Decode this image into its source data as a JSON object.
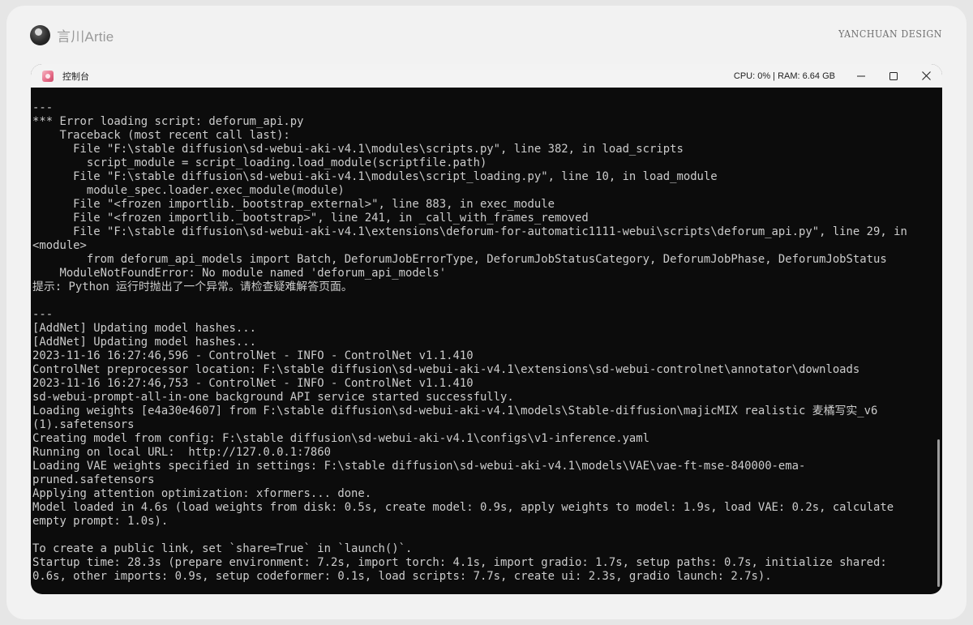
{
  "brand": {
    "name": "言川Artie",
    "design_label": "YANCHUAN DESIGN"
  },
  "window": {
    "title": "控制台",
    "status": "CPU: 0% | RAM: 6.64 GB",
    "controls": {
      "minimize": "minimize-icon",
      "maximize": "maximize-icon",
      "close": "close-icon"
    }
  },
  "console_lines": [
    "---",
    "*** Error loading script: deforum_api.py",
    "    Traceback (most recent call last):",
    "      File \"F:\\stable diffusion\\sd-webui-aki-v4.1\\modules\\scripts.py\", line 382, in load_scripts",
    "        script_module = script_loading.load_module(scriptfile.path)",
    "      File \"F:\\stable diffusion\\sd-webui-aki-v4.1\\modules\\script_loading.py\", line 10, in load_module",
    "        module_spec.loader.exec_module(module)",
    "      File \"<frozen importlib._bootstrap_external>\", line 883, in exec_module",
    "      File \"<frozen importlib._bootstrap>\", line 241, in _call_with_frames_removed",
    "      File \"F:\\stable diffusion\\sd-webui-aki-v4.1\\extensions\\deforum-for-automatic1111-webui\\scripts\\deforum_api.py\", line 29, in",
    "<module>",
    "        from deforum_api_models import Batch, DeforumJobErrorType, DeforumJobStatusCategory, DeforumJobPhase, DeforumJobStatus",
    "    ModuleNotFoundError: No module named 'deforum_api_models'",
    "提示: Python 运行时抛出了一个异常。请检查疑难解答页面。",
    "",
    "---",
    "[AddNet] Updating model hashes...",
    "[AddNet] Updating model hashes...",
    "2023-11-16 16:27:46,596 - ControlNet - INFO - ControlNet v1.1.410",
    "ControlNet preprocessor location: F:\\stable diffusion\\sd-webui-aki-v4.1\\extensions\\sd-webui-controlnet\\annotator\\downloads",
    "2023-11-16 16:27:46,753 - ControlNet - INFO - ControlNet v1.1.410",
    "sd-webui-prompt-all-in-one background API service started successfully.",
    "Loading weights [e4a30e4607] from F:\\stable diffusion\\sd-webui-aki-v4.1\\models\\Stable-diffusion\\majicMIX realistic 麦橘写实_v6",
    "(1).safetensors",
    "Creating model from config: F:\\stable diffusion\\sd-webui-aki-v4.1\\configs\\v1-inference.yaml",
    "Running on local URL:  http://127.0.0.1:7860",
    "Loading VAE weights specified in settings: F:\\stable diffusion\\sd-webui-aki-v4.1\\models\\VAE\\vae-ft-mse-840000-ema-",
    "pruned.safetensors",
    "Applying attention optimization: xformers... done.",
    "Model loaded in 4.6s (load weights from disk: 0.5s, create model: 0.9s, apply weights to model: 1.9s, load VAE: 0.2s, calculate",
    "empty prompt: 1.0s).",
    "",
    "To create a public link, set `share=True` in `launch()`.",
    "Startup time: 28.3s (prepare environment: 7.2s, import torch: 4.1s, import gradio: 1.7s, setup paths: 0.7s, initialize shared:",
    "0.6s, other imports: 0.9s, setup codeformer: 0.1s, load scripts: 7.7s, create ui: 2.3s, gradio launch: 2.7s)."
  ]
}
